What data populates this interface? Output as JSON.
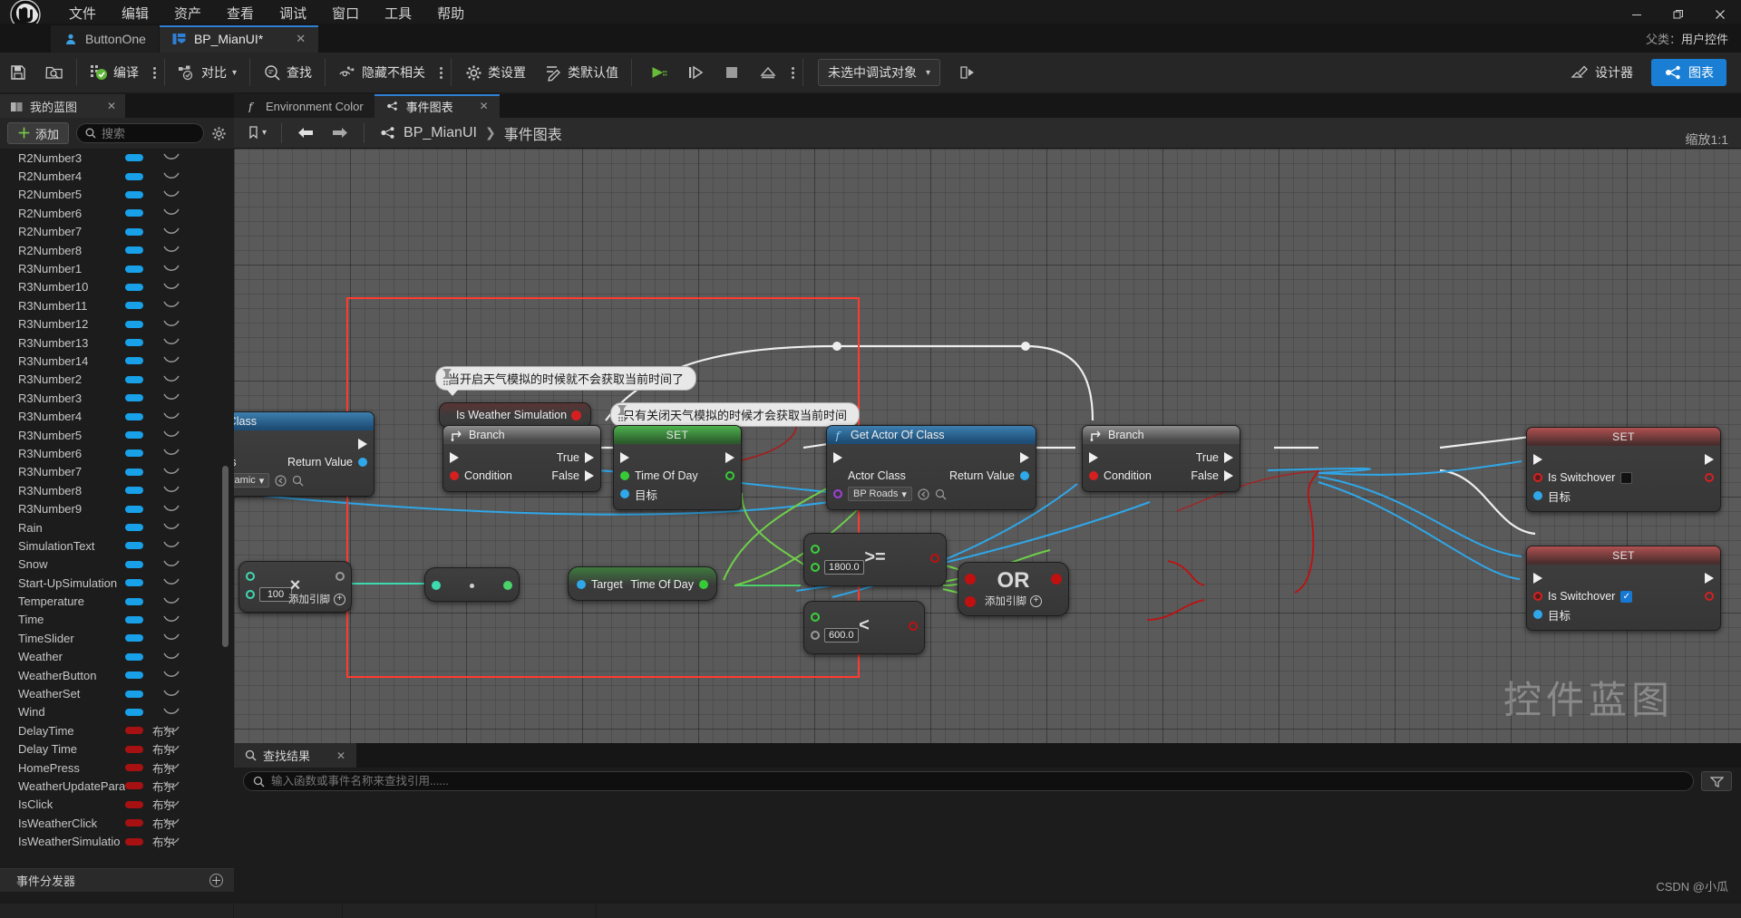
{
  "app": {
    "logo_icon": "unreal-engine-logo",
    "menu": [
      "文件",
      "编辑",
      "资产",
      "查看",
      "调试",
      "窗口",
      "工具",
      "帮助"
    ],
    "window_controls": {
      "minimize": "—",
      "restore": "❐",
      "close": "✕"
    }
  },
  "asset_tabs": [
    {
      "label": "ButtonOne",
      "icon": "blueprint-actor-icon",
      "active": false,
      "closable": false
    },
    {
      "label": "BP_MianUI*",
      "icon": "widget-blueprint-icon",
      "active": true,
      "closable": true,
      "close": "✕"
    }
  ],
  "breadcrumb_class": {
    "prefix": "父类：",
    "value": "用户控件"
  },
  "toolbar": {
    "save_icon": "save-icon",
    "browse_icon": "browse-content-icon",
    "compile_label": "编译",
    "compile_icon": "compile-icon",
    "diff_label": "对比",
    "diff_icon": "diff-icon",
    "find_label": "查找",
    "find_icon": "find-icon",
    "hide_unrelated_label": "隐藏不相关",
    "hide_unrelated_icon": "eye-hidden-icon",
    "class_settings_label": "类设置",
    "class_settings_icon": "gear-icon",
    "class_defaults_label": "类默认值",
    "class_defaults_icon": "pencil-list-icon",
    "play_icon": "play-icon",
    "step_icon": "step-icon",
    "stop_icon": "stop-icon",
    "eject_icon": "eject-icon",
    "more_icon": "kebab-icon",
    "debug_object": "未选中调试对象",
    "debug_chevron": "▾",
    "debug_extra_icon": "debug-filter-icon",
    "designer_label": "设计器",
    "designer_icon": "designer-icon",
    "graph_label": "图表",
    "graph_icon": "graph-icon"
  },
  "my_blueprint": {
    "panel_title": "我的蓝图",
    "panel_icon": "book-icon",
    "panel_close": "✕",
    "add_label": "添加",
    "search_placeholder": "搜索",
    "search_value": "",
    "settings_icon": "gear-icon",
    "event_dispatcher_label": "事件分发器",
    "event_dispatcher_add": "＋",
    "pin_blue": "#18a0e8",
    "pin_red": "#a81111",
    "variables": [
      {
        "name": "R2Number3",
        "type": "",
        "color": "#18a0e8"
      },
      {
        "name": "R2Number4",
        "type": "",
        "color": "#18a0e8"
      },
      {
        "name": "R2Number5",
        "type": "",
        "color": "#18a0e8"
      },
      {
        "name": "R2Number6",
        "type": "",
        "color": "#18a0e8"
      },
      {
        "name": "R2Number7",
        "type": "",
        "color": "#18a0e8"
      },
      {
        "name": "R2Number8",
        "type": "",
        "color": "#18a0e8"
      },
      {
        "name": "R3Number1",
        "type": "",
        "color": "#18a0e8"
      },
      {
        "name": "R3Number10",
        "type": "",
        "color": "#18a0e8"
      },
      {
        "name": "R3Number11",
        "type": "",
        "color": "#18a0e8"
      },
      {
        "name": "R3Number12",
        "type": "",
        "color": "#18a0e8"
      },
      {
        "name": "R3Number13",
        "type": "",
        "color": "#18a0e8"
      },
      {
        "name": "R3Number14",
        "type": "",
        "color": "#18a0e8"
      },
      {
        "name": "R3Number2",
        "type": "",
        "color": "#18a0e8"
      },
      {
        "name": "R3Number3",
        "type": "",
        "color": "#18a0e8"
      },
      {
        "name": "R3Number4",
        "type": "",
        "color": "#18a0e8"
      },
      {
        "name": "R3Number5",
        "type": "",
        "color": "#18a0e8"
      },
      {
        "name": "R3Number6",
        "type": "",
        "color": "#18a0e8"
      },
      {
        "name": "R3Number7",
        "type": "",
        "color": "#18a0e8"
      },
      {
        "name": "R3Number8",
        "type": "",
        "color": "#18a0e8"
      },
      {
        "name": "R3Number9",
        "type": "",
        "color": "#18a0e8"
      },
      {
        "name": "Rain",
        "type": "",
        "color": "#18a0e8"
      },
      {
        "name": "SimulationText",
        "type": "",
        "color": "#18a0e8"
      },
      {
        "name": "Snow",
        "type": "",
        "color": "#18a0e8"
      },
      {
        "name": "Start-UpSimulation",
        "type": "",
        "color": "#18a0e8"
      },
      {
        "name": "Temperature",
        "type": "",
        "color": "#18a0e8"
      },
      {
        "name": "Time",
        "type": "",
        "color": "#18a0e8"
      },
      {
        "name": "TimeSlider",
        "type": "",
        "color": "#18a0e8"
      },
      {
        "name": "Weather",
        "type": "",
        "color": "#18a0e8"
      },
      {
        "name": "WeatherButton",
        "type": "",
        "color": "#18a0e8"
      },
      {
        "name": "WeatherSet",
        "type": "",
        "color": "#18a0e8"
      },
      {
        "name": "Wind",
        "type": "",
        "color": "#18a0e8"
      },
      {
        "name": "DelayTime",
        "type": "布尔",
        "color": "#a81111"
      },
      {
        "name": "Delay Time",
        "type": "布尔",
        "color": "#a81111"
      },
      {
        "name": "HomePress",
        "type": "布尔",
        "color": "#a81111"
      },
      {
        "name": "WeatherUpdatePara",
        "type": "布尔",
        "color": "#a81111"
      },
      {
        "name": "IsClick",
        "type": "布尔",
        "color": "#a81111"
      },
      {
        "name": "IsWeatherClick",
        "type": "布尔",
        "color": "#a81111"
      },
      {
        "name": "IsWeatherSimulatio",
        "type": "布尔",
        "color": "#a81111"
      }
    ]
  },
  "graph": {
    "tabs": [
      {
        "label": "Environment Color",
        "icon": "function-icon",
        "active": false,
        "closable": false
      },
      {
        "label": "事件图表",
        "icon": "graph-icon",
        "active": true,
        "closable": true,
        "close": "✕"
      }
    ],
    "toolbar": {
      "bookmark_icon": "bookmark-icon",
      "bookmark_chevron": "▾",
      "back_icon": "arrow-left-icon",
      "forward_icon": "arrow-right-icon",
      "breadcrumb_icon": "graph-icon",
      "breadcrumb_root": "BP_MianUI",
      "breadcrumb_sep": "❯",
      "breadcrumb_leaf": "事件图表"
    },
    "zoom_label": "缩放1:1",
    "watermark": "控件蓝图",
    "selection_color": "#ff3b30",
    "comments": [
      {
        "id": "c1",
        "text": "当开启天气模拟的时候就不会获取当前时间了"
      },
      {
        "id": "c2",
        "text": "只有关闭天气模拟的时候才会获取当前时间"
      }
    ],
    "nodes": [
      {
        "id": "n_getactor_left",
        "title": "tor Of Class",
        "header": "blue",
        "pins": [
          {
            "label": "class",
            "right_label": "Return Value"
          }
        ],
        "combo": "Dynamic",
        "combo_chevron": "▾"
      },
      {
        "id": "n_isweathersim",
        "title": "Is Weather Simulation",
        "header": "red_var"
      },
      {
        "id": "n_branch_left",
        "title": "Branch",
        "header": "gray",
        "icon": "branch-icon",
        "true_label": "True",
        "false_label": "False",
        "condition_label": "Condition"
      },
      {
        "id": "n_set_timeofday",
        "title": "SET",
        "header": "green",
        "rows": [
          "Time Of Day",
          "目标"
        ]
      },
      {
        "id": "n_getactorofclass",
        "title": "Get Actor Of Class",
        "header": "blue",
        "icon": "function-icon",
        "actor_class_label": "Actor Class",
        "actor_class_value": "BP Roads",
        "actor_class_chevron": "▾",
        "return_label": "Return Value"
      },
      {
        "id": "n_branch_right",
        "title": "Branch",
        "header": "gray",
        "icon": "branch-icon",
        "true_label": "True",
        "false_label": "False",
        "condition_label": "Condition"
      },
      {
        "id": "n_set_switchover_1",
        "title": "SET",
        "header": "red",
        "prop_label": "Is Switchover",
        "prop_checked": false,
        "target_label": "目标"
      },
      {
        "id": "n_set_switchover_2",
        "title": "SET",
        "header": "red",
        "prop_label": "Is Switchover",
        "prop_checked": true,
        "target_label": "目标"
      },
      {
        "id": "n_multiply",
        "title": "×",
        "header": "none",
        "value": "100",
        "add_pin_label": "添加引脚",
        "add_pin_icon": "plus-circle-icon"
      },
      {
        "id": "n_passthrough",
        "title": "·",
        "header": "none"
      },
      {
        "id": "n_target_timeofday",
        "title": "",
        "header": "green",
        "target_label": "Target",
        "out_label": "Time Of Day"
      },
      {
        "id": "n_gte",
        "title": ">=",
        "header": "none",
        "value": "1800.0"
      },
      {
        "id": "n_lt",
        "title": "<",
        "header": "none",
        "value": "600.0"
      },
      {
        "id": "n_or",
        "title": "OR",
        "header": "none",
        "add_pin_label": "添加引脚",
        "add_pin_icon": "plus-circle-icon"
      }
    ]
  },
  "find_results": {
    "tab_label": "查找结果",
    "tab_icon": "search-icon",
    "tab_close": "✕",
    "search_placeholder": "输入函数或事件名称来查找引用......",
    "search_value": "",
    "filter_icon": "filter-icon",
    "watermark": "CSDN @小瓜"
  }
}
